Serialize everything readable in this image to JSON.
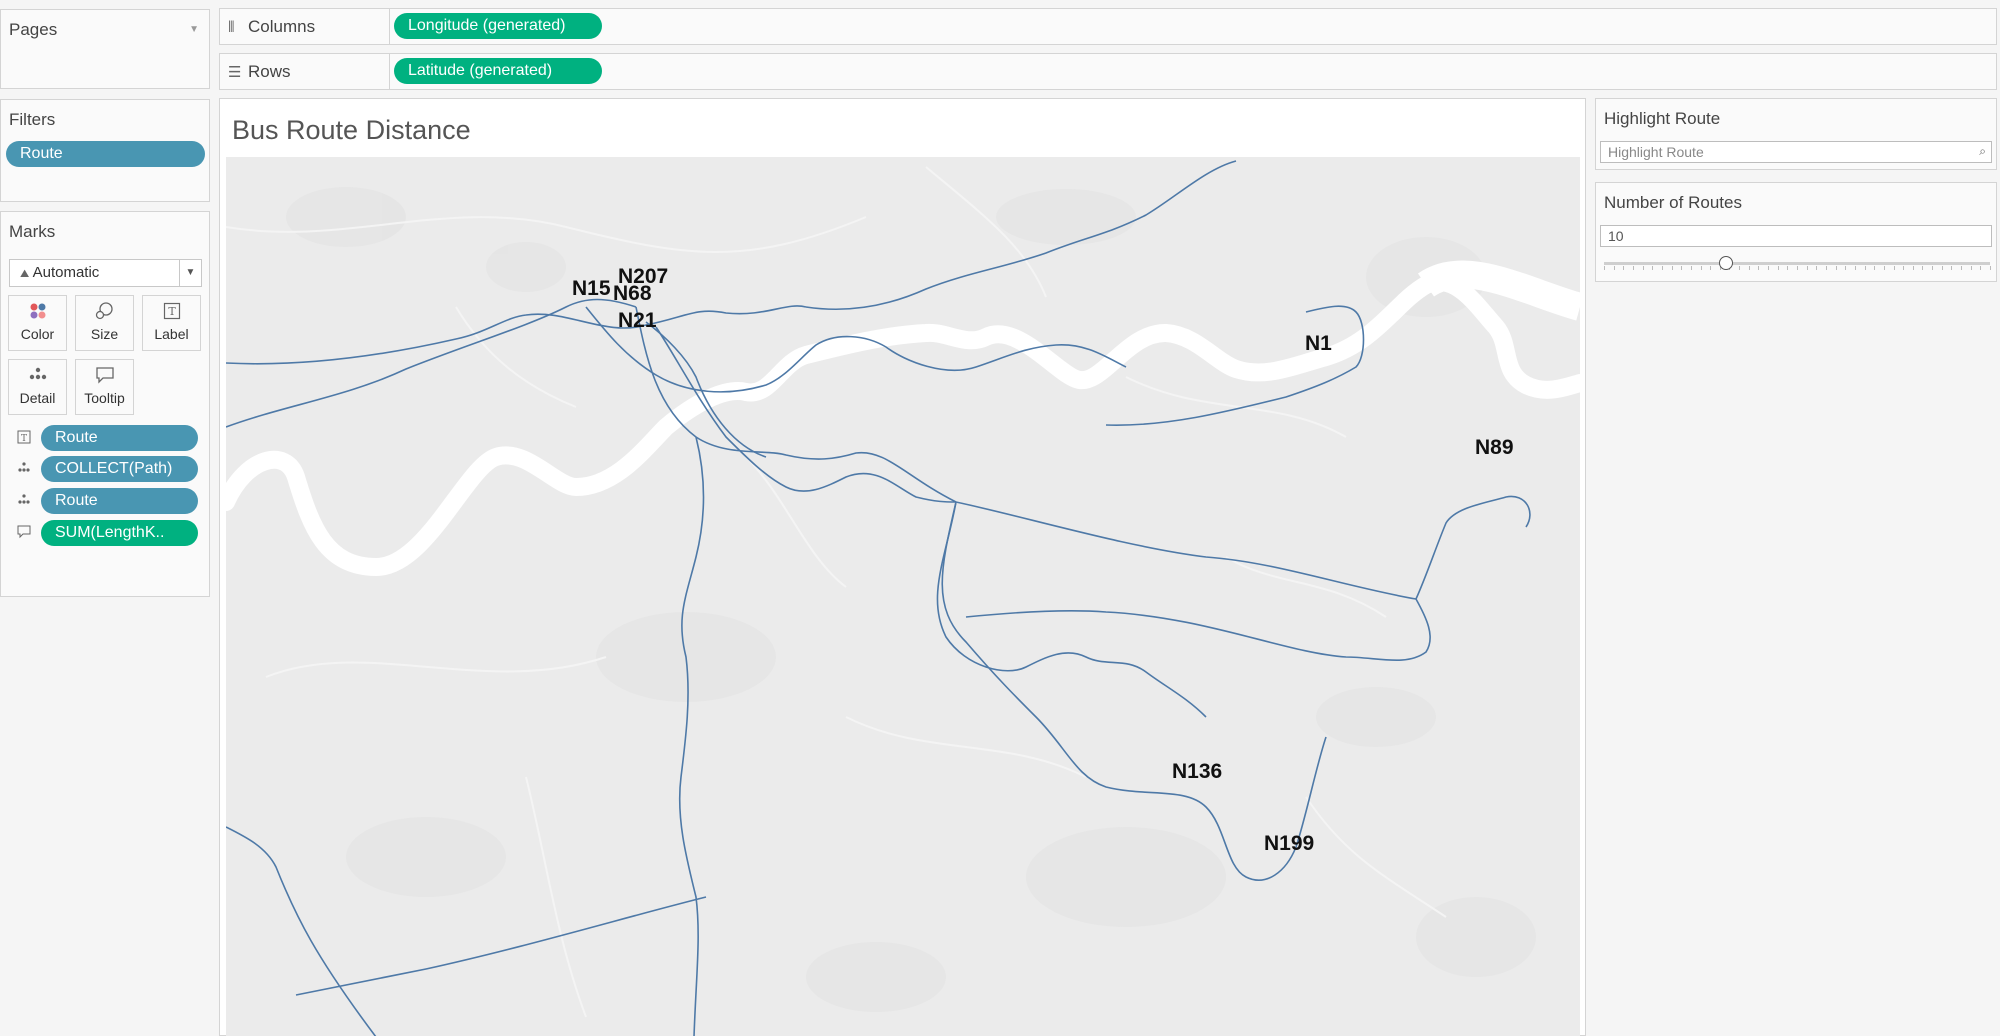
{
  "pages": {
    "title": "Pages"
  },
  "shelves": {
    "columns": {
      "label": "Columns",
      "pill": "Longitude (generated)"
    },
    "rows": {
      "label": "Rows",
      "pill": "Latitude (generated)"
    }
  },
  "filters": {
    "title": "Filters",
    "pills": [
      "Route"
    ]
  },
  "marks": {
    "title": "Marks",
    "mark_type": "Automatic",
    "buttons": [
      "Color",
      "Size",
      "Label",
      "Detail",
      "Tooltip"
    ],
    "fields": [
      {
        "icon": "label-icon",
        "label": "Route",
        "color": "#4996b2"
      },
      {
        "icon": "detail-icon",
        "label": "COLLECT(Path)",
        "color": "#4996b2"
      },
      {
        "icon": "detail-icon",
        "label": "Route",
        "color": "#4996b2"
      },
      {
        "icon": "tooltip-icon",
        "label": "SUM(LengthK..",
        "color": "#00b180"
      }
    ]
  },
  "viz": {
    "title": "Bus Route Distance",
    "route_labels": [
      "N15",
      "N207",
      "N68",
      "N21",
      "N1",
      "N89",
      "N136",
      "N199"
    ],
    "route_color": "#4e79a7",
    "river_color": "#ffffff",
    "land_color": "#ebebeb"
  },
  "highlight_route": {
    "title": "Highlight Route",
    "placeholder": "Highlight Route"
  },
  "number_of_routes": {
    "title": "Number of Routes",
    "value": "10"
  }
}
